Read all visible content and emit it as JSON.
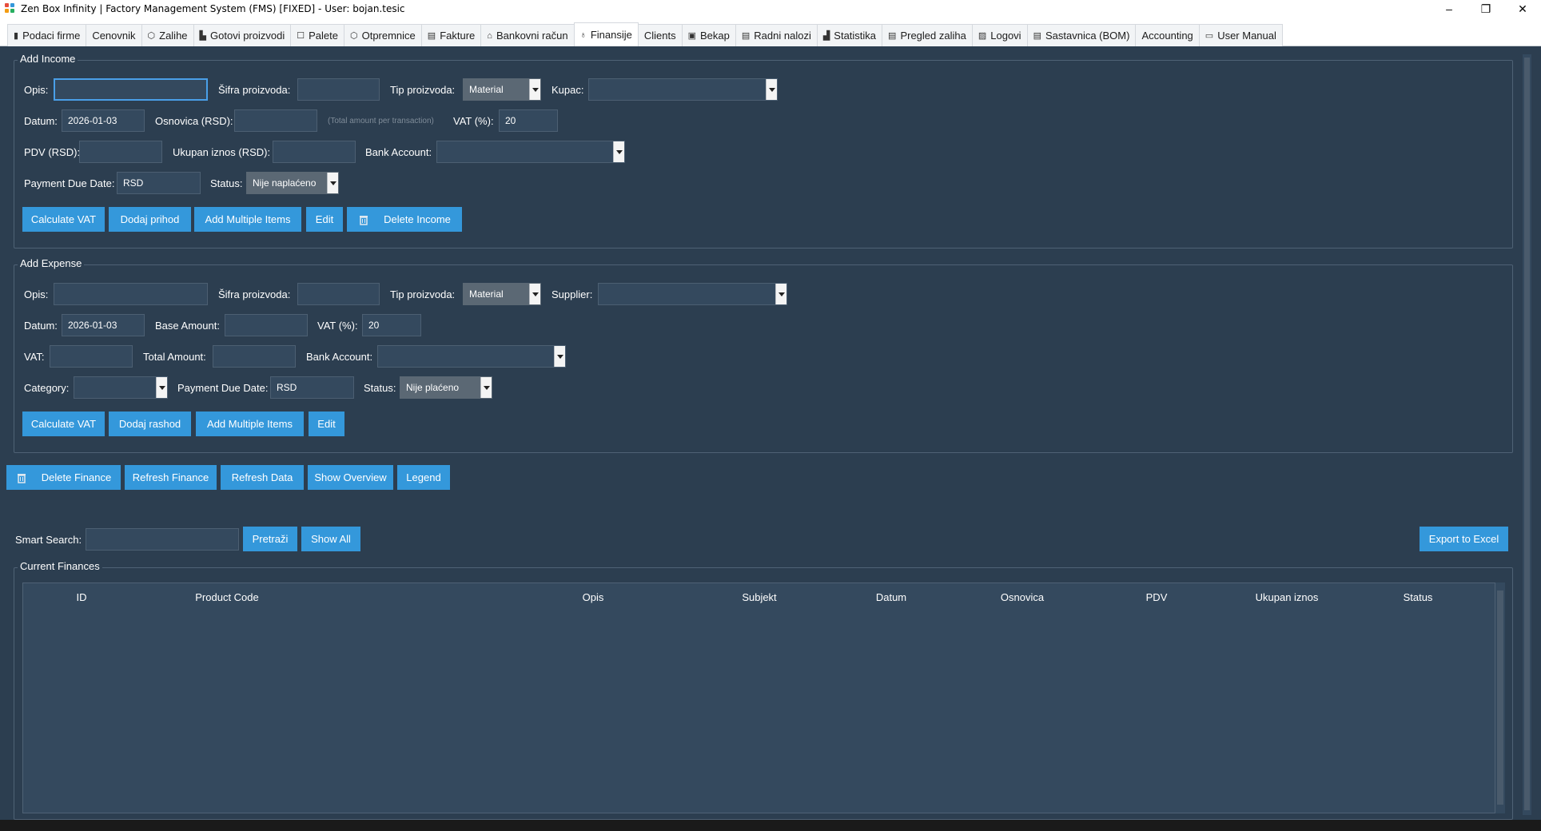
{
  "window": {
    "title": "Zen Box Infinity | Factory Management System (FMS) [FIXED] - User: bojan.tesic",
    "minimize_icon": "minimize-icon",
    "maximize_icon": "restore-icon",
    "close_icon": "close-icon",
    "minimize": "–",
    "maximize": "❐",
    "close": "✕"
  },
  "tabs": [
    {
      "label": "Podaci firme",
      "icon": "building-icon",
      "glyph": "▮"
    },
    {
      "label": "Cenovnik",
      "icon": "",
      "glyph": ""
    },
    {
      "label": "Zalihe",
      "icon": "box-icon",
      "glyph": "⬡"
    },
    {
      "label": "Gotovi proizvodi",
      "icon": "factory-icon",
      "glyph": "▙"
    },
    {
      "label": "Palete",
      "icon": "pallet-icon",
      "glyph": "☐"
    },
    {
      "label": "Otpremnice",
      "icon": "package-icon",
      "glyph": "⬡"
    },
    {
      "label": "Fakture",
      "icon": "invoice-icon",
      "glyph": "▤"
    },
    {
      "label": "Bankovni račun",
      "icon": "bank-icon",
      "glyph": "⌂"
    },
    {
      "label": "Finansije",
      "icon": "money-bag-icon",
      "glyph": "♁"
    },
    {
      "label": "Clients",
      "icon": "",
      "glyph": ""
    },
    {
      "label": "Bekap",
      "icon": "save-icon",
      "glyph": "▣"
    },
    {
      "label": "Radni nalozi",
      "icon": "clipboard-icon",
      "glyph": "▤"
    },
    {
      "label": "Statistika",
      "icon": "chart-icon",
      "glyph": "▟"
    },
    {
      "label": "Pregled zaliha",
      "icon": "document-icon",
      "glyph": "▤"
    },
    {
      "label": "Logovi",
      "icon": "log-icon",
      "glyph": "▨"
    },
    {
      "label": "Sastavnica (BOM)",
      "icon": "list-icon",
      "glyph": "▤"
    },
    {
      "label": "Accounting",
      "icon": "",
      "glyph": ""
    },
    {
      "label": "User Manual",
      "icon": "book-icon",
      "glyph": "▭"
    }
  ],
  "income": {
    "group_label": "Add Income",
    "opis_label": "Opis:",
    "opis_value": "",
    "sifra_label": "Šifra proizvoda:",
    "sifra_value": "",
    "tip_label": "Tip proizvoda:",
    "tip_value": "Material",
    "kupac_label": "Kupac:",
    "kupac_value": "",
    "datum_label": "Datum:",
    "datum_value": "2026-01-03",
    "osnovica_label": "Osnovica (RSD):",
    "osnovica_value": "",
    "osnovica_hint": "(Total amount per transaction)",
    "vat_label": "VAT (%):",
    "vat_value": "20",
    "pdv_label": "PDV (RSD):",
    "pdv_value": "",
    "ukupan_label": "Ukupan iznos (RSD):",
    "ukupan_value": "",
    "bank_label": "Bank Account:",
    "bank_value": "",
    "due_label": "Payment Due Date:",
    "due_value": "RSD",
    "status_label": "Status:",
    "status_value": "Nije naplaćeno",
    "btn_calc": "Calculate VAT",
    "btn_add": "Dodaj prihod",
    "btn_multi": "Add Multiple Items",
    "btn_edit": "Edit",
    "btn_delete": "Delete Income"
  },
  "expense": {
    "group_label": "Add Expense",
    "opis_label": "Opis:",
    "opis_value": "",
    "sifra_label": "Šifra proizvoda:",
    "sifra_value": "",
    "tip_label": "Tip proizvoda:",
    "tip_value": "Material",
    "supplier_label": "Supplier:",
    "supplier_value": "",
    "datum_label": "Datum:",
    "datum_value": "2026-01-03",
    "base_label": "Base Amount:",
    "base_value": "",
    "vat_pct_label": "VAT (%):",
    "vat_pct_value": "20",
    "vat_label": "VAT:",
    "vat_value": "",
    "total_label": "Total Amount:",
    "total_value": "",
    "bank_label": "Bank Account:",
    "bank_value": "",
    "category_label": "Category:",
    "category_value": "",
    "due_label": "Payment Due Date:",
    "due_value": "RSD",
    "status_label": "Status:",
    "status_value": "Nije plaćeno",
    "btn_calc": "Calculate VAT",
    "btn_add": "Dodaj rashod",
    "btn_multi": "Add Multiple Items",
    "btn_edit": "Edit"
  },
  "actions": {
    "delete": "Delete Finance",
    "refresh_finance": "Refresh Finance",
    "refresh_data": "Refresh Data",
    "overview": "Show Overview",
    "legend": "Legend"
  },
  "search": {
    "label": "Smart Search:",
    "value": "",
    "btn_search": "Pretraži",
    "btn_show_all": "Show All",
    "btn_export": "Export to Excel"
  },
  "table": {
    "group_label": "Current Finances",
    "columns": [
      "ID",
      "Product Code",
      "Opis",
      "Subjekt",
      "Datum",
      "Osnovica",
      "PDV",
      "Ukupan iznos",
      "Status"
    ],
    "rows": []
  },
  "colors": {
    "background": "#2c3e50",
    "button": "#3498db",
    "input": "#34495e"
  }
}
